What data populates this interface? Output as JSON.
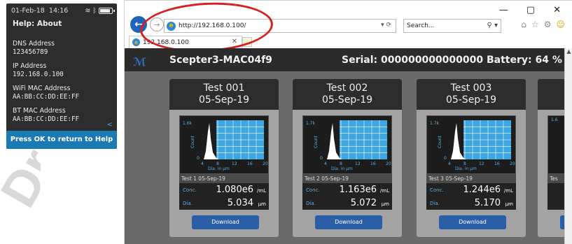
{
  "device": {
    "date": "01-Feb-18",
    "time": "14:16",
    "title": "Help: About",
    "fields": [
      {
        "label": "DNS Address",
        "value": "123456789"
      },
      {
        "label": "IP Address",
        "value": "192.168.0.100"
      },
      {
        "label": "WiFi MAC Address",
        "value": "AA:BB:CC:DD:EE:FF"
      },
      {
        "label": "BT MAC Address",
        "value": "AA:BB:CC:DD:EE:FF"
      }
    ],
    "back_glyph": "<",
    "footer": "Press OK to return to Help"
  },
  "browser": {
    "url": "http://192.168.0.100/",
    "search_placeholder": "Search...",
    "tab_title": "192.168.0.100",
    "window_controls": [
      "—",
      "▢",
      "✕"
    ],
    "icons": [
      "back-arrow-icon",
      "forward-arrow-icon",
      "ie-logo-icon",
      "refresh-icon",
      "home-icon",
      "star-icon",
      "gear-icon",
      "smiley-icon"
    ]
  },
  "app": {
    "logo": "ℳ",
    "model": "Scepter3-MAC04f9",
    "serial": "Serial: 000000000000000 Battery: 64 %",
    "cards": [
      {
        "name": "Test 001",
        "date": "05-Sep-19",
        "plot_caption": "Test 1  05-Sep-19",
        "conc": "1.080e6",
        "conc_unit": "/mL",
        "dia": "5.034",
        "dia_unit": "µm",
        "ymax": "1.6k",
        "button": "Download"
      },
      {
        "name": "Test 002",
        "date": "05-Sep-19",
        "plot_caption": "Test 2  05-Sep-19",
        "conc": "1.163e6",
        "conc_unit": "/mL",
        "dia": "5.072",
        "dia_unit": "µm",
        "ymax": "1.7k",
        "button": "Download"
      },
      {
        "name": "Test 003",
        "date": "05-Sep-19",
        "plot_caption": "Test 3  05-Sep-19",
        "conc": "1.244e6",
        "conc_unit": "/mL",
        "dia": "5.170",
        "dia_unit": "µm",
        "ymax": "1.7k",
        "button": "Download"
      }
    ],
    "labels": {
      "conc": "Conc.",
      "dia": "Dia.",
      "axis_x": "Dia. in µm",
      "axis_y": "Count",
      "ticks_x": [
        "4",
        "8",
        "12",
        "16",
        "20"
      ],
      "y_zero": "0"
    },
    "partial_card": {
      "plot_ymax": "1.6",
      "caption": "Tes"
    }
  },
  "colors": {
    "accent": "#2b76c8",
    "device_footer": "#1b7ab3",
    "circle": "#d52020",
    "plot_grid": "#5ab4e8"
  }
}
